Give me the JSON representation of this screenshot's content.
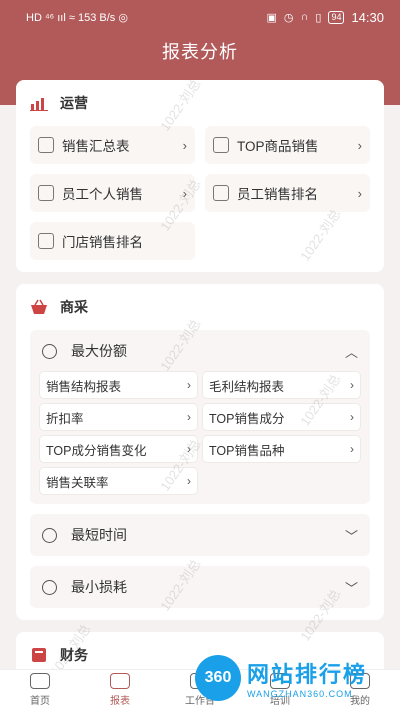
{
  "status_bar": {
    "left": "HD ⁴⁶ ııl ≈ 153 B/s ◎",
    "time": "14:30",
    "battery": "94"
  },
  "nav": {
    "title": "报表分析"
  },
  "sections": {
    "ops": {
      "title": "运营",
      "items": [
        "销售汇总表",
        "TOP商品销售",
        "员工个人销售",
        "员工销售排名",
        "门店销售排名"
      ]
    },
    "procurement": {
      "title": "商采",
      "max_share": {
        "title": "最大份额",
        "items": [
          "销售结构报表",
          "毛利结构报表",
          "折扣率",
          "TOP销售成分",
          "TOP成分销售变化",
          "TOP销售品种",
          "销售关联率"
        ]
      },
      "shortest_time": {
        "title": "最短时间"
      },
      "min_loss": {
        "title": "最小损耗"
      }
    },
    "finance": {
      "title": "财务"
    }
  },
  "watermark": "1022-刘总",
  "tabbar": {
    "home": "首页",
    "reports": "报表",
    "workbench": "工作台",
    "training": "培训",
    "mine": "我的"
  },
  "promo": {
    "badge": "360",
    "main": "网站排行榜",
    "sub": "WANGZHAN360.COM"
  },
  "colors": {
    "brand": "#b25a5a",
    "promo": "#1aa0e8"
  }
}
